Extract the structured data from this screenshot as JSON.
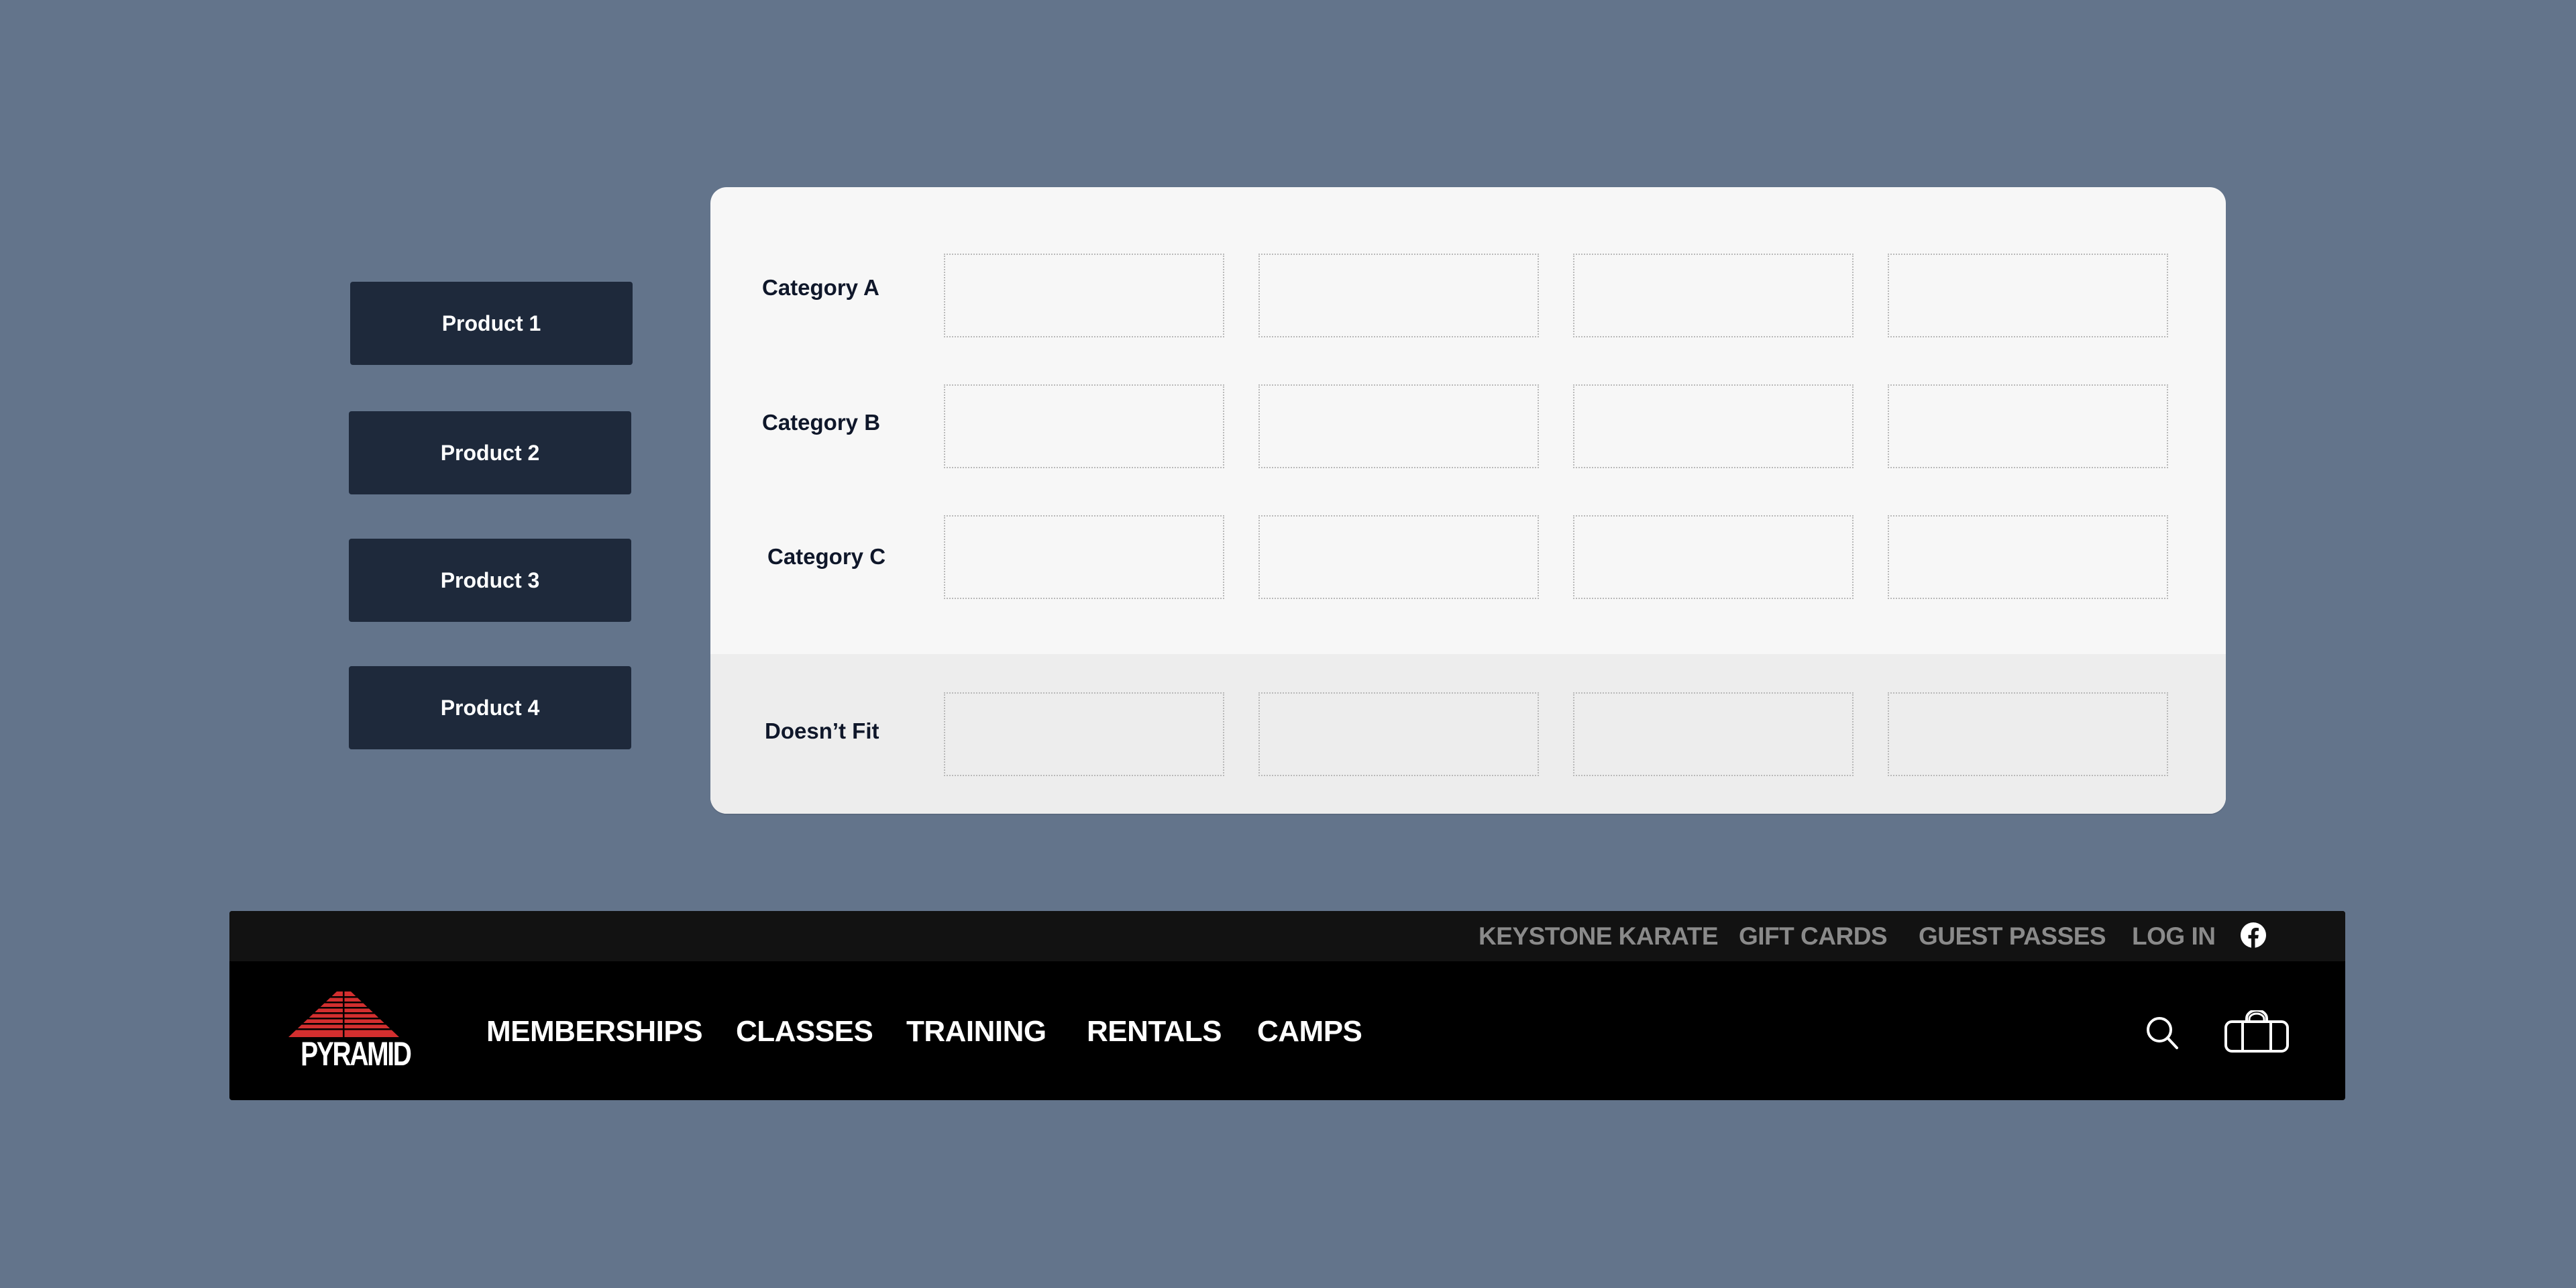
{
  "products": [
    {
      "label": "Product 1"
    },
    {
      "label": "Product 2"
    },
    {
      "label": "Product 3"
    },
    {
      "label": "Product 4"
    }
  ],
  "categories": [
    {
      "label": "Category A",
      "slots": [
        "",
        "",
        "",
        ""
      ]
    },
    {
      "label": "Category B",
      "slots": [
        "",
        "",
        "",
        ""
      ]
    },
    {
      "label": "Category C",
      "slots": [
        "",
        "",
        "",
        ""
      ]
    }
  ],
  "doesnt_fit": {
    "label": "Doesn’t Fit",
    "slots": [
      "",
      "",
      "",
      ""
    ]
  },
  "nav": {
    "brand": "PYRAMID",
    "brand_color": "#d32f2f",
    "utility_links": [
      {
        "label": "KEYSTONE KARATE"
      },
      {
        "label": "GIFT CARDS"
      },
      {
        "label": "GUEST PASSES"
      },
      {
        "label": "LOG IN"
      }
    ],
    "social_icon": "facebook-icon",
    "main_links": [
      {
        "label": "MEMBERSHIPS"
      },
      {
        "label": "CLASSES"
      },
      {
        "label": "TRAINING"
      },
      {
        "label": "RENTALS"
      },
      {
        "label": "CAMPS"
      }
    ],
    "icons": [
      "search-icon",
      "bag-icon"
    ]
  },
  "colors": {
    "background": "#63748b",
    "product_button": "#1e293b",
    "panel": "#f7f7f7",
    "panel_bottom": "#ededed",
    "label_text": "#0f172a"
  }
}
